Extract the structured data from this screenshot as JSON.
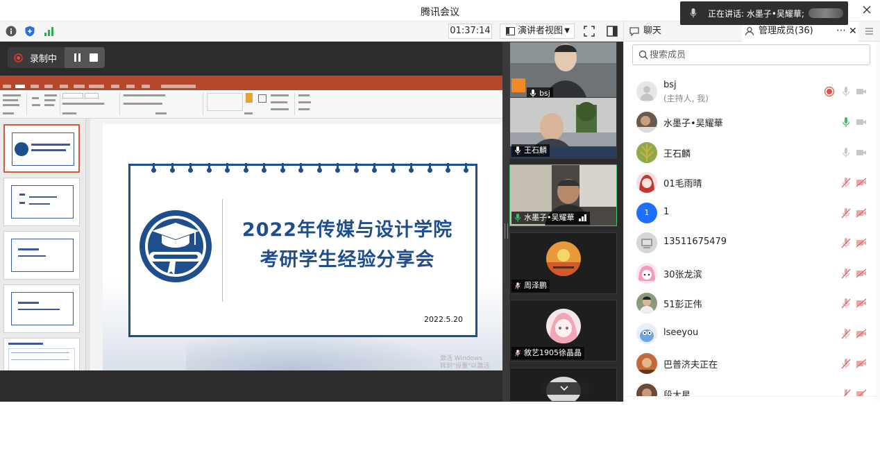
{
  "window": {
    "title": "腾讯会议"
  },
  "speaking_banner": {
    "label": "正在讲话: 水墨子•吴耀華;"
  },
  "toolbar": {
    "timer": "01:37:14",
    "view_label": "演讲者视图"
  },
  "recording": {
    "label": "录制中"
  },
  "right_panel": {
    "chat_tab": "聊天",
    "members_tab": "管理成员(36)",
    "search_placeholder": "搜索成员"
  },
  "slide": {
    "title_line1": "2022年传媒与设计学院",
    "title_line2": "考研学生经验分享会",
    "date": "2022.5.20"
  },
  "watermark": {
    "line1": "激活 Windows",
    "line2": "转到\"设置\"以激活 Windows。"
  },
  "video_tiles": [
    {
      "name": "bsj"
    },
    {
      "name": "王石麟"
    },
    {
      "name": "水墨子•吴耀華"
    },
    {
      "name": "周泽鹏"
    },
    {
      "name": "敘艺1905徐晶晶"
    }
  ],
  "members": [
    {
      "name": "bsj",
      "sub": "(主持人, 我)"
    },
    {
      "name": "水墨子•吴耀華"
    },
    {
      "name": "王石麟"
    },
    {
      "name": "01毛雨晴"
    },
    {
      "name": "1",
      "avatar_text": "1"
    },
    {
      "name": "13511675479"
    },
    {
      "name": "30张龙滨"
    },
    {
      "name": "51彭正伟"
    },
    {
      "name": "lseeyou"
    },
    {
      "name": "巴普济夫正在"
    },
    {
      "name": "段大星"
    }
  ],
  "colors": {
    "accent_blue": "#1f4e8c",
    "ppt_red": "#b7472a",
    "active_green": "#3fbf6a",
    "muted_red": "#e06c6c"
  }
}
